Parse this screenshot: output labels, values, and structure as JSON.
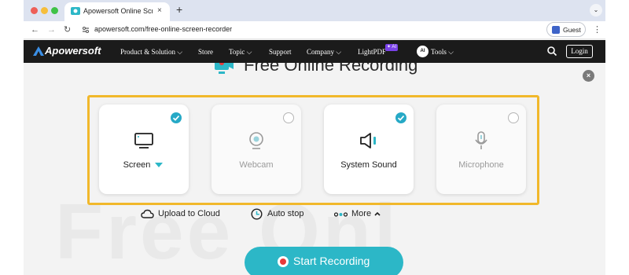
{
  "browser": {
    "tab_title": "Apowersoft Online Screen Re",
    "tab_close": "×",
    "new_tab": "+",
    "tab_menu": "⌄",
    "back": "←",
    "forward": "→",
    "reload": "↻",
    "url": "apowersoft.com/free-online-screen-recorder",
    "guest_label": "Guest",
    "menu": "⋮"
  },
  "sitenav": {
    "logo": "Apowersoft",
    "items": [
      "Product & Solution ⌵",
      "Store",
      "Topic ⌵",
      "Support",
      "Company ⌵",
      "LightPDF",
      "Tools ⌵"
    ],
    "ai_badge": "✦ AI",
    "tools_badge": "AI",
    "login": "Login"
  },
  "recorder": {
    "heading": "Free Online Recording",
    "background_word": "Free Onl",
    "close": "×",
    "cards": [
      {
        "label": "Screen",
        "checked": true,
        "icon": "monitor-icon"
      },
      {
        "label": "Webcam",
        "checked": false,
        "icon": "webcam-icon"
      },
      {
        "label": "System Sound",
        "checked": true,
        "icon": "speaker-icon"
      },
      {
        "label": "Microphone",
        "checked": false,
        "icon": "microphone-icon"
      }
    ],
    "options": [
      {
        "label": "Upload to Cloud",
        "icon": "cloud-icon"
      },
      {
        "label": "Auto stop",
        "icon": "clock-icon"
      },
      {
        "label": "More",
        "icon": "dots-icon"
      }
    ],
    "start_label": "Start Recording"
  },
  "colors": {
    "accent_teal": "#2cb7c7",
    "check_blue": "#26a9c6",
    "highlight_yellow": "#f1b82b",
    "nav_dark": "#1b1b1b",
    "record_red": "#e83a3a"
  }
}
